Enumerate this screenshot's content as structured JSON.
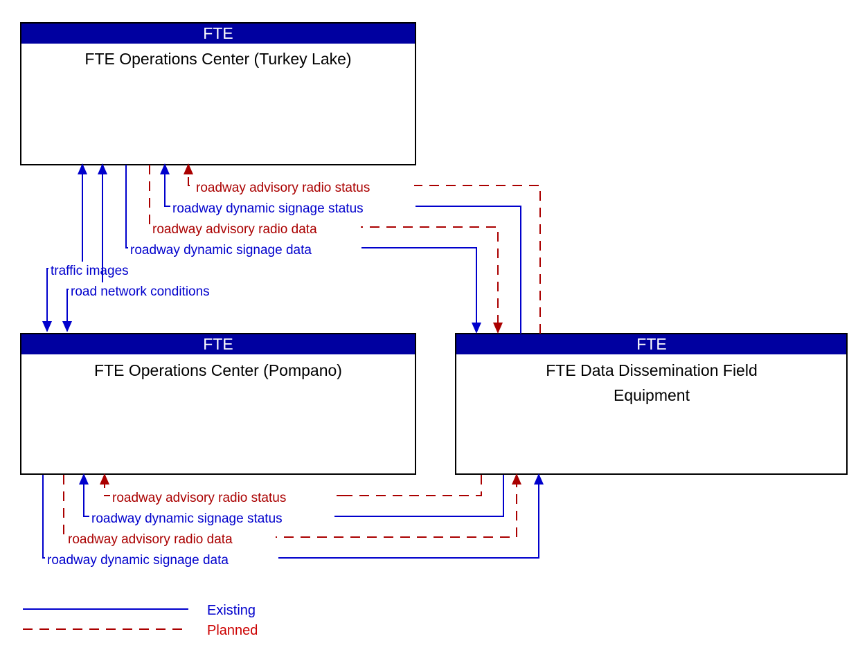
{
  "diagram": {
    "boxes": [
      {
        "id": "fte-operations-center-turkey-lake",
        "header": "FTE",
        "title_line1": "FTE Operations Center (Turkey Lake)",
        "title_line2": ""
      },
      {
        "id": "fte-operations-center-pompano",
        "header": "FTE",
        "title_line1": "FTE Operations Center (Pompano)",
        "title_line2": ""
      },
      {
        "id": "fte-data-dissemination-field-equipment",
        "header": "FTE",
        "title_line1": "FTE Data Dissemination Field",
        "title_line2": "Equipment"
      }
    ],
    "upper_flows": [
      {
        "label": "roadway advisory radio status",
        "status": "planned"
      },
      {
        "label": "roadway dynamic signage status",
        "status": "existing"
      },
      {
        "label": "roadway advisory radio data",
        "status": "planned"
      },
      {
        "label": "roadway dynamic signage data",
        "status": "existing"
      }
    ],
    "center_flows": [
      {
        "label": "traffic images",
        "status": "existing"
      },
      {
        "label": "road network conditions",
        "status": "existing"
      }
    ],
    "lower_flows": [
      {
        "label": "roadway advisory radio status",
        "status": "planned"
      },
      {
        "label": "roadway dynamic signage status",
        "status": "existing"
      },
      {
        "label": "roadway advisory radio data",
        "status": "planned"
      },
      {
        "label": "roadway dynamic signage data",
        "status": "existing"
      }
    ],
    "legend": {
      "existing_label": "Existing",
      "planned_label": "Planned"
    },
    "colors": {
      "header_fill": "#0000a0",
      "existing": "#0000cc",
      "planned": "#aa0000",
      "box_border": "#000000",
      "background": "#ffffff"
    }
  }
}
